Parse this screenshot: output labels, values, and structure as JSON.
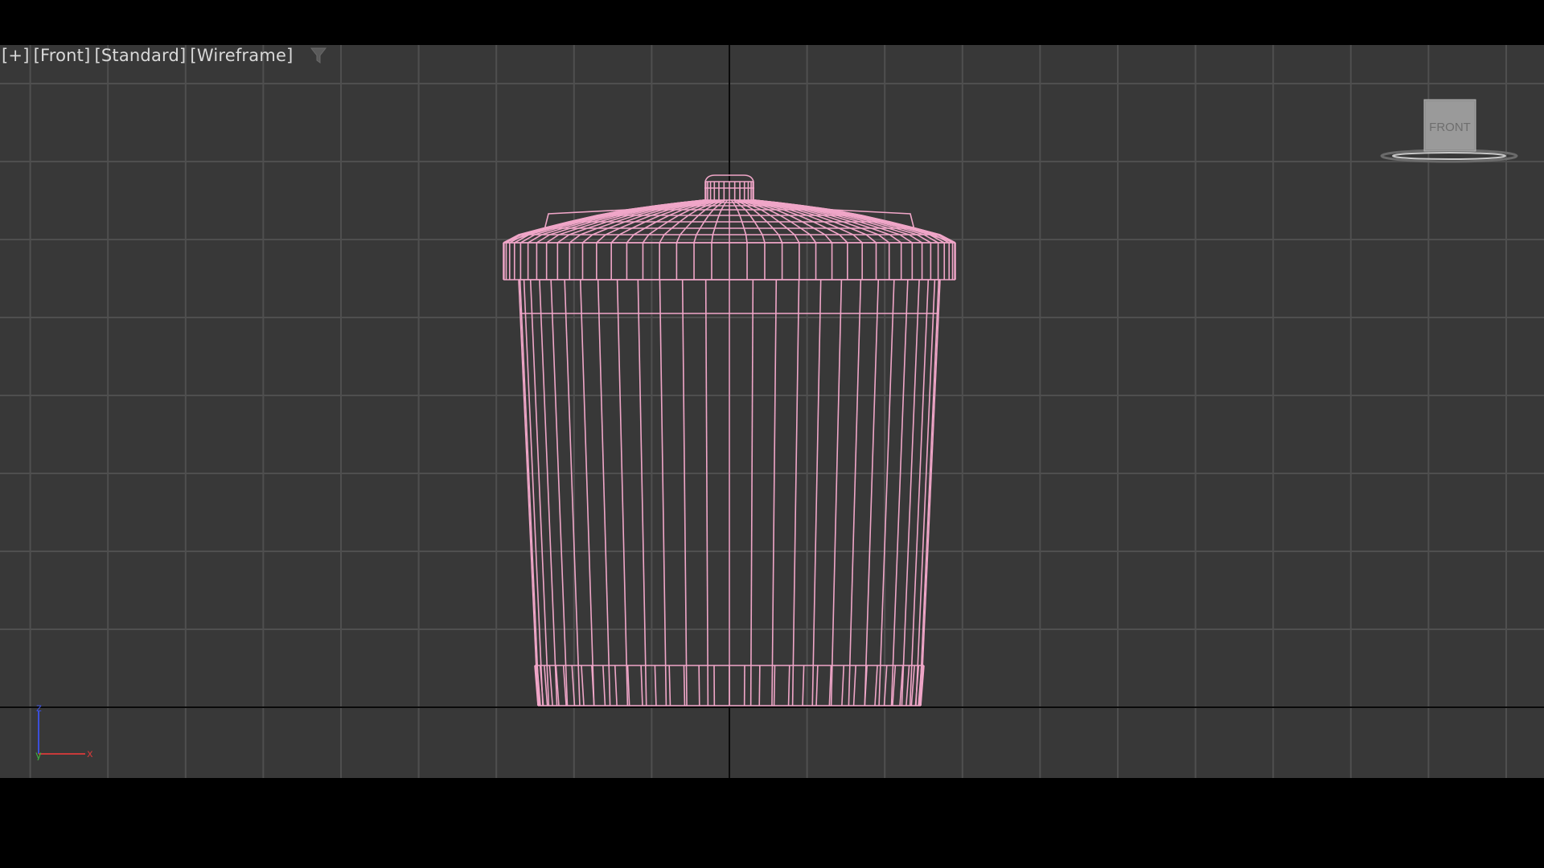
{
  "viewport": {
    "labels": {
      "menu": "[+]",
      "view": "[Front]",
      "shading_mode": "[Standard]",
      "display_mode": "[Wireframe]"
    },
    "filter_icon": "funnel-icon"
  },
  "viewcube": {
    "face_label": "FRONT"
  },
  "axis_tripod": {
    "x_label": "x",
    "y_label": "y",
    "z_label": "z",
    "colors": {
      "x": "#c83a3a",
      "y": "#3fae3f",
      "z": "#3b4fd9"
    }
  },
  "scene": {
    "object": "trash-can-wireframe",
    "wire_color": "#f0a6c8",
    "grid_color": "#4f4f4f",
    "grid_major_color": "#0a0a0a",
    "background_color": "#383838"
  }
}
